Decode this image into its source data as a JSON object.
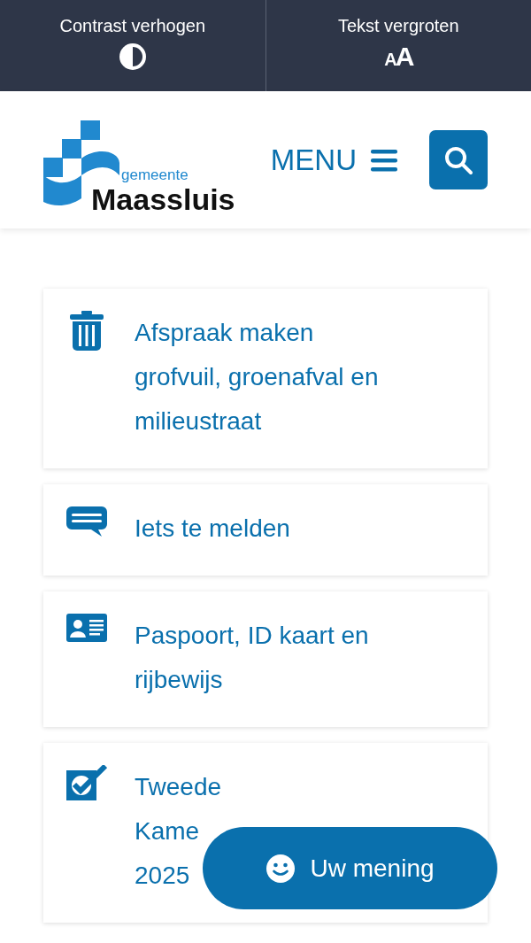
{
  "accessibility_bar": [
    {
      "kind": "contrast",
      "label": "Contrast verhogen"
    },
    {
      "kind": "text-size",
      "label": "Tekst vergroten",
      "icon_text": "AA"
    }
  ],
  "header": {
    "logo": {
      "subtitle": "gemeente",
      "name": "Maassluis"
    },
    "menu_label": "MENU"
  },
  "tiles": [
    {
      "kind": "trash",
      "title": "Afspraak maken\ngrofvuil, groenafval en\nmilieustraat"
    },
    {
      "kind": "chat",
      "title": "Iets te melden"
    },
    {
      "kind": "id-card",
      "title": "Paspoort, ID kaart en\nrijbewijs"
    },
    {
      "kind": "checkbox",
      "title": "Tweede\nKame\n2025"
    }
  ],
  "feedback_button": {
    "label": "Uw mening"
  }
}
